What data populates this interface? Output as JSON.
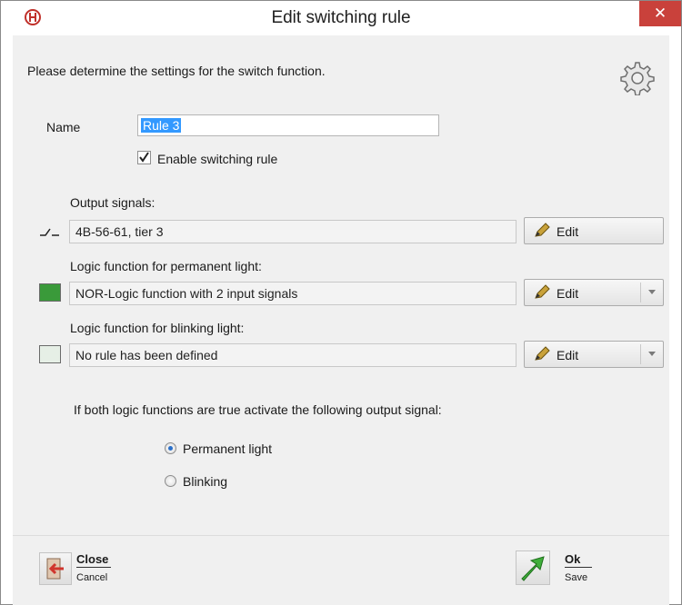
{
  "window": {
    "title": "Edit switching rule",
    "close_glyph": "✕"
  },
  "intro_text": "Please determine the settings for the switch function.",
  "name": {
    "label": "Name",
    "value": "Rule 3"
  },
  "enable": {
    "label": "Enable switching rule",
    "checked": true
  },
  "output_signals": {
    "label": "Output signals:",
    "value": "4B-56-61, tier 3",
    "edit_label": "Edit"
  },
  "permanent_light": {
    "label": "Logic function for permanent light:",
    "value": "NOR-Logic function with 2 input signals",
    "edit_label": "Edit",
    "indicator_color": "#3a9a3a"
  },
  "blinking_light": {
    "label": "Logic function for blinking light:",
    "value": "No rule has been defined",
    "edit_label": "Edit",
    "indicator_color": "#e6efe6"
  },
  "activation_text": "If both logic functions are true activate the following output signal:",
  "radio_options": [
    {
      "label": "Permanent light",
      "selected": true
    },
    {
      "label": "Blinking",
      "selected": false
    }
  ],
  "footer": {
    "close": {
      "main": "Close",
      "sub": "Cancel"
    },
    "ok": {
      "main": "Ok",
      "sub": "Save"
    }
  }
}
